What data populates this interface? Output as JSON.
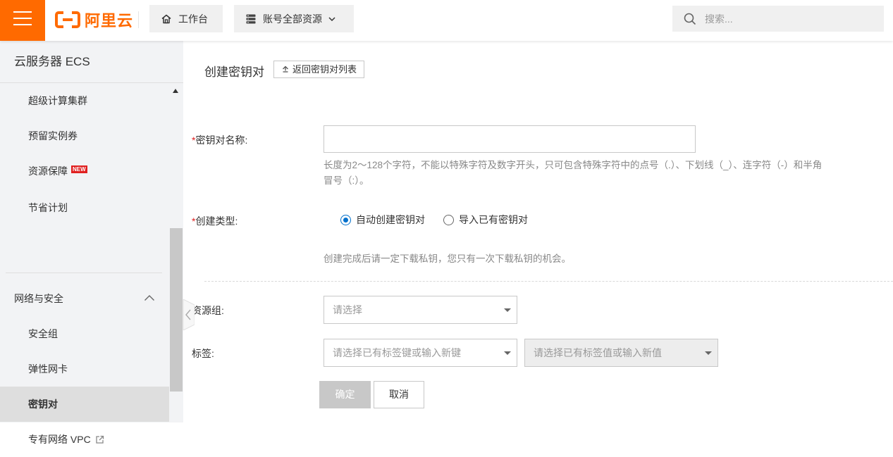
{
  "header": {
    "brand": "阿里云",
    "workbench": "工作台",
    "resources": "账号全部资源",
    "search_placeholder": "搜索..."
  },
  "sidebar": {
    "title": "云服务器 ECS",
    "items": [
      {
        "label": "超级计算集群"
      },
      {
        "label": "预留实例券"
      },
      {
        "label": "资源保障",
        "badge": "NEW"
      },
      {
        "label": "节省计划"
      }
    ],
    "group": {
      "label": "网络与安全"
    },
    "group_items": [
      {
        "label": "安全组"
      },
      {
        "label": "弹性网卡"
      },
      {
        "label": "密钥对",
        "active": true
      },
      {
        "label": "专有网络 VPC"
      }
    ]
  },
  "main": {
    "title": "创建密钥对",
    "back_button": "返回密钥对列表",
    "form": {
      "name_required_mark": "*",
      "name_label": "密钥对名称:",
      "name_value": "",
      "name_hint_line1": "长度为2～128个字符，不能以特殊字符及数字开头，只可包含特殊字符中的点号（.）、下划线（_）、连字符（-）和半角",
      "name_hint_line2": "冒号（:）。",
      "type_required_mark": "*",
      "type_label": "创建类型:",
      "type_options": [
        {
          "label": "自动创建密钥对",
          "checked": true
        },
        {
          "label": "导入已有密钥对",
          "checked": false
        }
      ],
      "type_hint": "创建完成后请一定下载私钥，您只有一次下载私钥的机会。",
      "resource_group_label": "资源组:",
      "resource_group_placeholder": "请选择",
      "tag_label": "标签:",
      "tag_key_placeholder": "请选择已有标签键或输入新键",
      "tag_value_placeholder": "请选择已有标签值或输入新值",
      "ok_button": "确定",
      "cancel_button": "取消"
    }
  },
  "colors": {
    "brand": "#ff6a00",
    "primary": "#0070cc",
    "required": "#e02020"
  }
}
